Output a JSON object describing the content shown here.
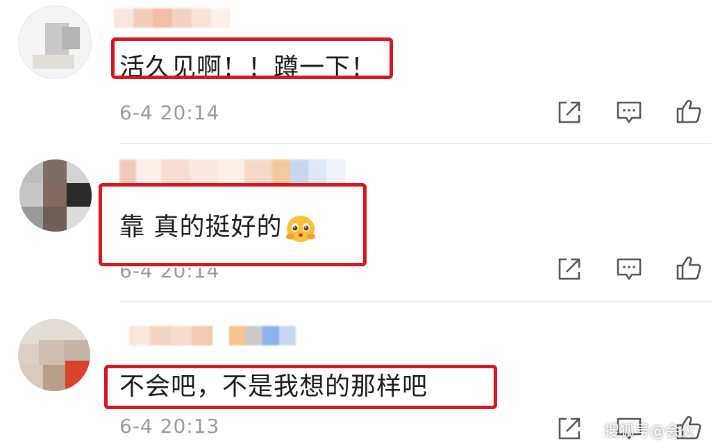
{
  "comments": [
    {
      "text": "活久见啊！！蹲一下！",
      "time": "6-4 20:14"
    },
    {
      "text": "靠 真的挺好的",
      "time": "6-4 20:14"
    },
    {
      "text": "不会吧，不是我想的那样吧",
      "time": "6-4 20:13"
    }
  ],
  "actions": {
    "share_icon": "share-icon",
    "reply_icon": "comment-icon",
    "like_icon": "thumbs-up-icon"
  },
  "watermark": "搜狐号@会火",
  "colors": {
    "highlight_box": "#d8141c",
    "timestamp": "#9a9a9a",
    "text": "#1a1a1a"
  }
}
